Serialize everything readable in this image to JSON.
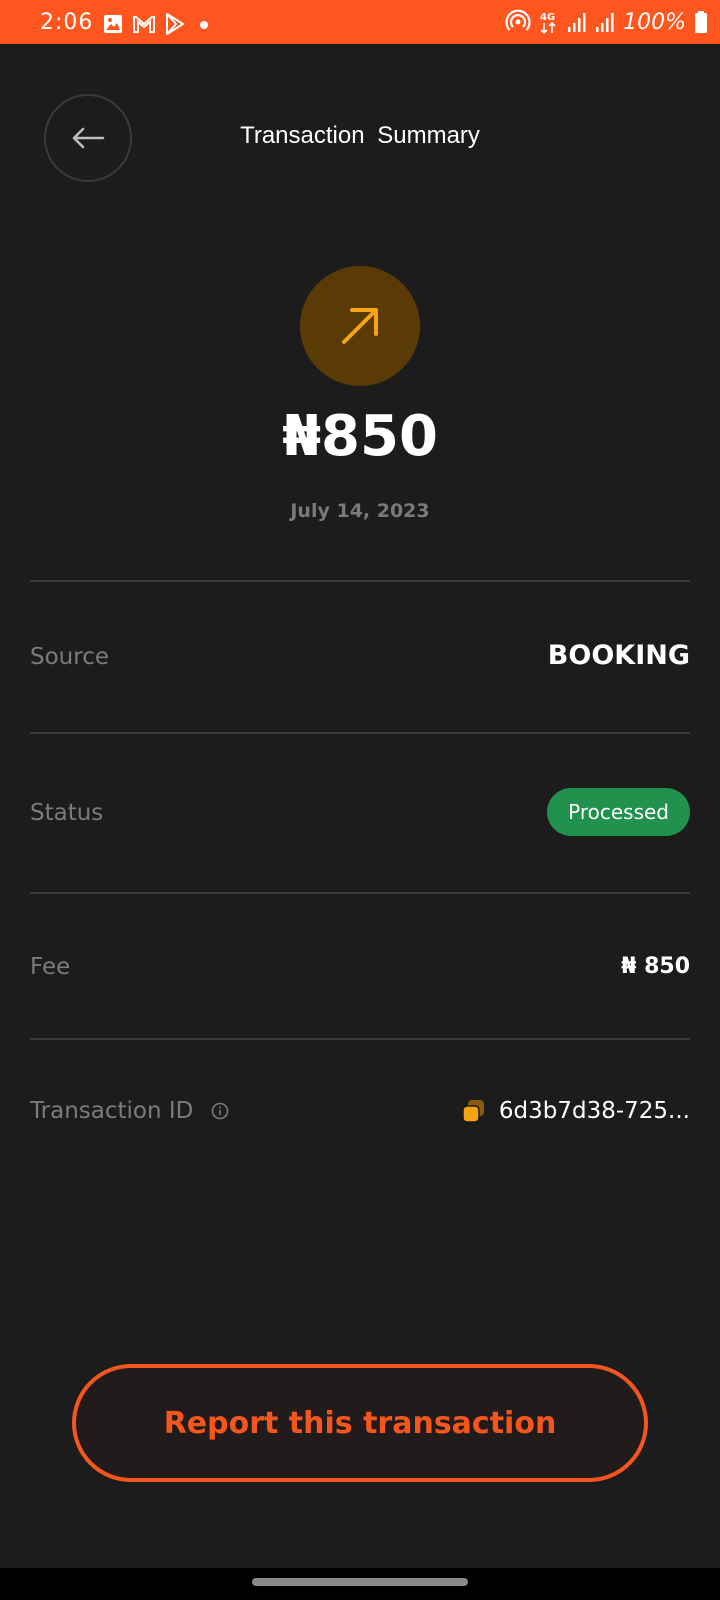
{
  "status_bar": {
    "time": "2:06",
    "battery": "100%",
    "network": "4G",
    "background_color": "#fe561e",
    "left_icons": [
      "gallery-icon",
      "gmail-icon",
      "play-store-icon",
      "dot-icon"
    ],
    "right_icons": [
      "hotspot-icon",
      "4g-icon",
      "signal-icon",
      "signal-icon",
      "battery-icon"
    ]
  },
  "header": {
    "title": "Transaction  Summary",
    "back_icon": "arrow-left-icon"
  },
  "summary": {
    "direction_icon": "arrow-up-right-icon",
    "amount": "₦850",
    "date": "July 14, 2023"
  },
  "details": {
    "source": {
      "label": "Source",
      "value": "BOOKING"
    },
    "status": {
      "label": "Status",
      "value": "Processed",
      "color": "#20924d"
    },
    "fee": {
      "label": "Fee",
      "value": "₦ 850"
    },
    "transaction_id": {
      "label": "Transaction ID",
      "value": "6d3b7d38-725...",
      "info_icon": "info-icon",
      "copy_icon": "copy-icon"
    }
  },
  "actions": {
    "report_label": "Report this transaction",
    "accent_color": "#f4561e"
  }
}
